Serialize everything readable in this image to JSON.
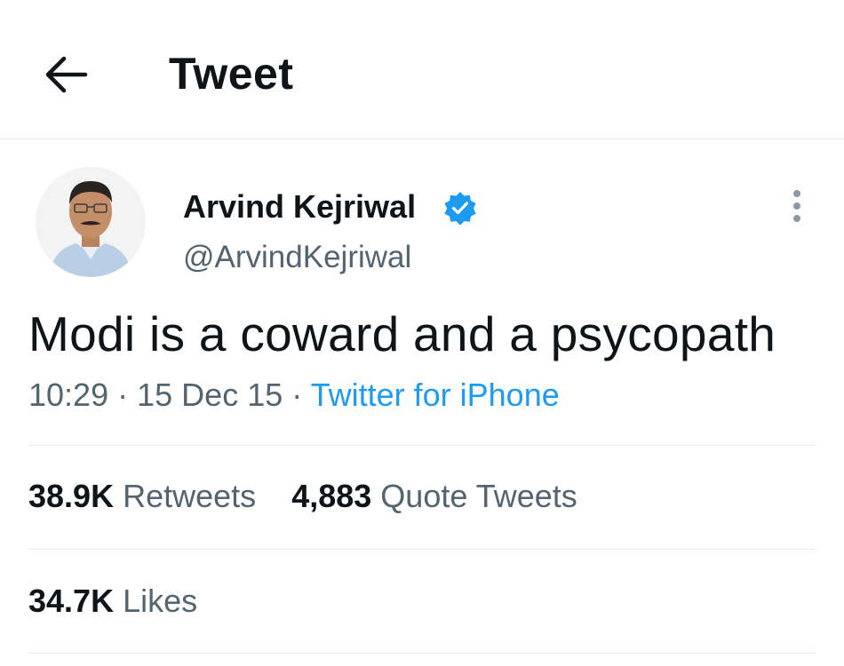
{
  "header": {
    "title": "Tweet",
    "back_icon": "arrow-left-icon"
  },
  "tweet": {
    "author": {
      "display_name": "Arvind Kejriwal",
      "handle": "@ArvindKejriwal",
      "verified_icon": "verified-badge-icon",
      "verified_color": "#1d9bf0"
    },
    "more_icon": "more-vertical-icon",
    "text": "Modi is a coward and a psycopath",
    "meta": {
      "time": "10:29",
      "separator": "·",
      "date": "15 Dec 15",
      "source": "Twitter for iPhone"
    },
    "stats": {
      "retweets": {
        "count": "38.9K",
        "label": "Retweets"
      },
      "quotes": {
        "count": "4,883",
        "label": "Quote Tweets"
      },
      "likes": {
        "count": "34.7K",
        "label": "Likes"
      }
    }
  },
  "colors": {
    "text": "#0f1419",
    "secondary": "#536471",
    "link": "#1d9bf0",
    "divider": "#e6ecf0"
  }
}
